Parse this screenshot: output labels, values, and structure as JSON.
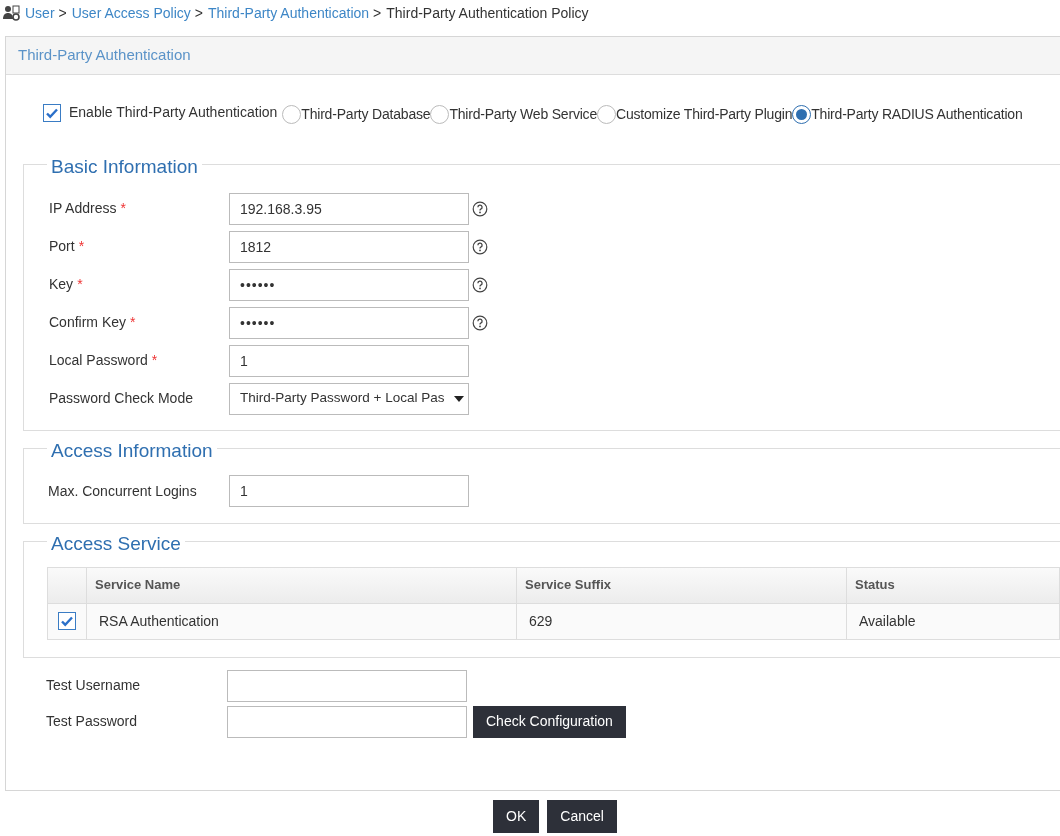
{
  "breadcrumb": [
    {
      "label": "User",
      "link": true
    },
    {
      "label": "User Access Policy",
      "link": true
    },
    {
      "label": "Third-Party Authentication",
      "link": true
    },
    {
      "label": "Third-Party Authentication Policy",
      "link": false
    }
  ],
  "breadcrumb_separator": ">",
  "panel": {
    "title": "Third-Party Authentication"
  },
  "enable": {
    "label": "Enable Third-Party Authentication",
    "checked": true
  },
  "sources": [
    {
      "label": "Third-Party Database",
      "selected": false
    },
    {
      "label": "Third-Party Web Service",
      "selected": false
    },
    {
      "label": "Customize Third-Party Plugin",
      "selected": false
    },
    {
      "label": "Third-Party RADIUS Authentication",
      "selected": true
    }
  ],
  "basic": {
    "title": "Basic Information",
    "fields": [
      {
        "label": "IP Address",
        "required": true,
        "kind": "text",
        "value": "192.168.3.95",
        "help": true
      },
      {
        "label": "Port",
        "required": true,
        "kind": "text",
        "value": "1812",
        "help": true
      },
      {
        "label": "Key",
        "required": true,
        "kind": "password",
        "value": "••••••",
        "help": true
      },
      {
        "label": "Confirm Key",
        "required": true,
        "kind": "password",
        "value": "••••••",
        "help": true
      },
      {
        "label": "Local Password",
        "required": true,
        "kind": "text",
        "value": "1",
        "help": false
      },
      {
        "label": "Password Check Mode",
        "required": false,
        "kind": "select",
        "value": "Third-Party Password + Local Pas",
        "help": false
      }
    ]
  },
  "access": {
    "title": "Access Information",
    "fields": [
      {
        "label": "Max. Concurrent Logins",
        "value": "1"
      }
    ]
  },
  "service": {
    "title": "Access Service",
    "columns": [
      "Service Name",
      "Service Suffix",
      "Status"
    ],
    "rows": [
      {
        "checked": true,
        "cells": [
          "RSA Authentication",
          "629",
          "Available"
        ]
      }
    ]
  },
  "test": {
    "fields": [
      {
        "label": "Test Username"
      },
      {
        "label": "Test Password"
      }
    ],
    "check_button": "Check Configuration"
  },
  "buttons": [
    "OK",
    "Cancel"
  ],
  "required_mark": "*"
}
